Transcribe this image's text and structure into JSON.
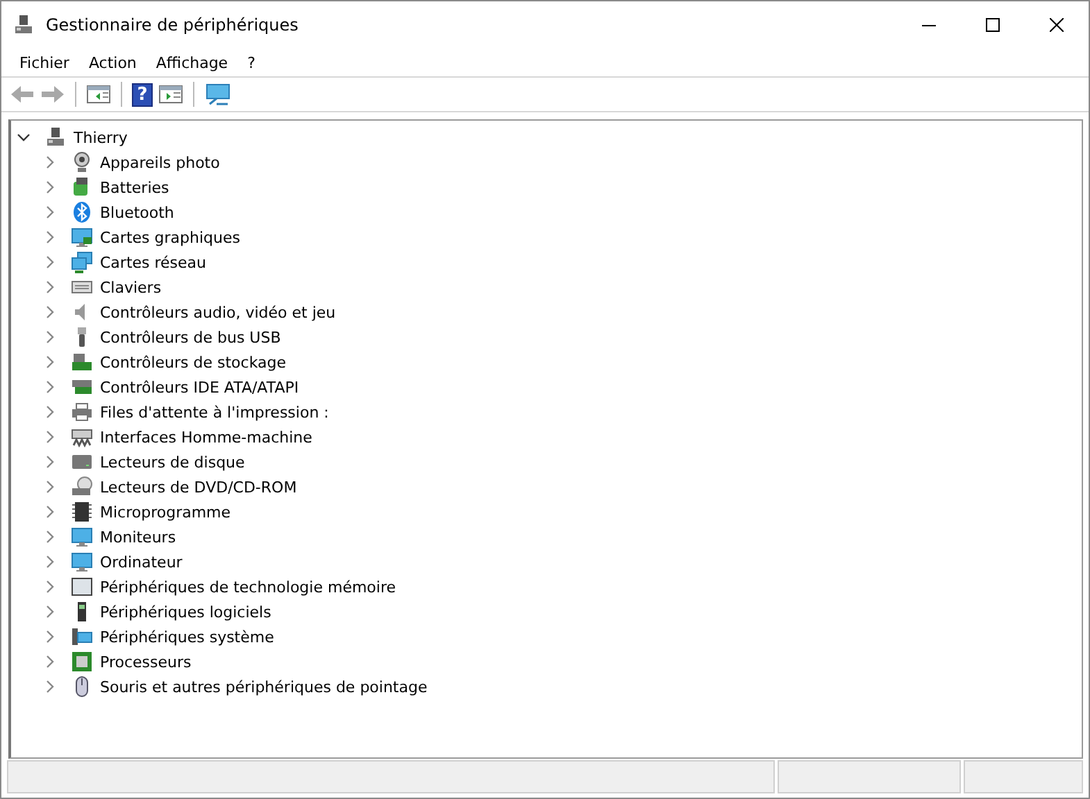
{
  "window": {
    "title": "Gestionnaire de périphériques"
  },
  "menu": [
    "Fichier",
    "Action",
    "Affichage",
    "?"
  ],
  "toolbar": [
    {
      "kind": "back",
      "disabled": true
    },
    {
      "kind": "forward",
      "disabled": true
    },
    {
      "kind": "sep"
    },
    {
      "kind": "tree"
    },
    {
      "kind": "sep"
    },
    {
      "kind": "help",
      "glyph": "?"
    },
    {
      "kind": "panel"
    },
    {
      "kind": "sep"
    },
    {
      "kind": "scan"
    }
  ],
  "tree": {
    "label": "Thierry",
    "expanded": true,
    "children": [
      {
        "label": "Appareils photo",
        "kind": "webcam",
        "expanded": false
      },
      {
        "label": "Batteries",
        "kind": "battery",
        "expanded": false
      },
      {
        "label": "Bluetooth",
        "kind": "bluetooth",
        "expanded": false
      },
      {
        "label": "Cartes graphiques",
        "kind": "display",
        "expanded": false
      },
      {
        "label": "Cartes réseau",
        "kind": "network",
        "expanded": false
      },
      {
        "label": "Claviers",
        "kind": "keyboard",
        "expanded": false
      },
      {
        "label": "Contrôleurs audio, vidéo et jeu",
        "kind": "speaker",
        "expanded": false
      },
      {
        "label": "Contrôleurs de bus USB",
        "kind": "usb",
        "expanded": false
      },
      {
        "label": "Contrôleurs de stockage",
        "kind": "storage",
        "expanded": false
      },
      {
        "label": "Contrôleurs IDE ATA/ATAPI",
        "kind": "card",
        "expanded": false
      },
      {
        "label": "Files d'attente à l'impression :",
        "kind": "printer",
        "expanded": false
      },
      {
        "label": "Interfaces Homme-machine",
        "kind": "hid",
        "expanded": false
      },
      {
        "label": "Lecteurs de disque",
        "kind": "drive",
        "expanded": false
      },
      {
        "label": "Lecteurs de DVD/CD-ROM",
        "kind": "disc",
        "expanded": false
      },
      {
        "label": "Microprogramme",
        "kind": "chip",
        "expanded": false
      },
      {
        "label": "Moniteurs",
        "kind": "monitor",
        "expanded": false
      },
      {
        "label": "Ordinateur",
        "kind": "monitor",
        "expanded": false
      },
      {
        "label": "Périphériques de technologie mémoire",
        "kind": "memory",
        "expanded": false
      },
      {
        "label": "Périphériques logiciels",
        "kind": "device",
        "expanded": false
      },
      {
        "label": "Périphériques système",
        "kind": "system",
        "expanded": false
      },
      {
        "label": "Processeurs",
        "kind": "cpu",
        "expanded": false
      },
      {
        "label": "Souris et autres périphériques de pointage",
        "kind": "mouse",
        "expanded": false
      }
    ]
  }
}
